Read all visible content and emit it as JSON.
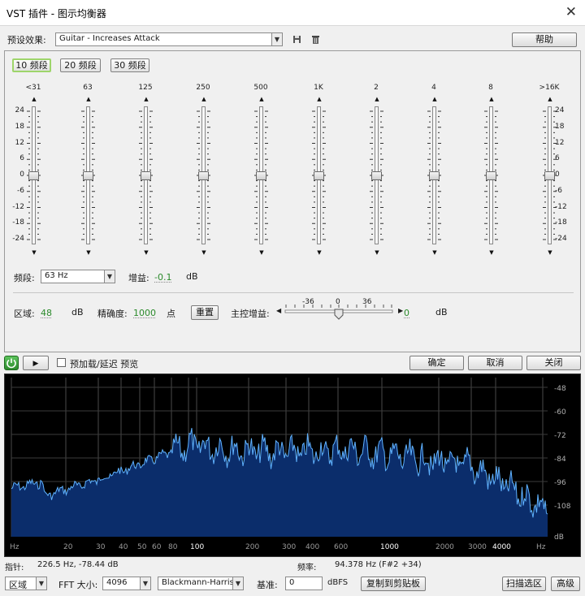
{
  "window": {
    "title": "VST 插件 - 图示均衡器",
    "close_glyph": "✕"
  },
  "preset": {
    "label": "预设效果:",
    "value": "Guitar - Increases Attack",
    "help_button": "帮助"
  },
  "bands": {
    "buttons": [
      "10 频段",
      "20 频段",
      "30 频段"
    ],
    "active_index": 0,
    "frequencies": [
      "<31",
      "63",
      "125",
      "250",
      "500",
      "1K",
      "2",
      "4",
      "8",
      ">16K"
    ],
    "gains_db": [
      0,
      0,
      0,
      0,
      0,
      0,
      0,
      0,
      0,
      0
    ],
    "db_scale": [
      "24",
      "18",
      "12",
      "6",
      "0",
      "-6",
      "-12",
      "-18",
      "-24"
    ],
    "db_range": [
      -24,
      24
    ]
  },
  "band_select": {
    "label": "频段:",
    "value": "63 Hz",
    "gain_label": "增益:",
    "gain_value": "-0.1",
    "gain_unit": "dB"
  },
  "range_row": {
    "range_label": "区域:",
    "range_value": "48",
    "range_unit": "dB",
    "accuracy_label": "精确度:",
    "accuracy_value": "1000",
    "accuracy_unit": "点",
    "reset_button": "重置",
    "master_label": "主控增益:",
    "master_scale": [
      "-36",
      "0",
      "36"
    ],
    "master_value": "0",
    "master_unit": "dB"
  },
  "controls": {
    "preload_label": "预加载/延迟 预览",
    "preload_checked": false,
    "ok": "确定",
    "cancel": "取消",
    "close": "关闭"
  },
  "spectrum": {
    "x_ticks": [
      "Hz",
      "20",
      "30",
      "40",
      "50",
      "60",
      "80",
      "100",
      "200",
      "300",
      "400",
      "600",
      "1000",
      "2000",
      "3000",
      "4000",
      "Hz"
    ],
    "y_ticks": [
      "-48",
      "-60",
      "-72",
      "-84",
      "-96",
      "-108",
      "dB"
    ],
    "fill_color": "#0b2d6b",
    "line_color": "#5fb2ff"
  },
  "status": {
    "cursor_label": "指针:",
    "cursor_value": "226.5 Hz, -78.44 dB",
    "freq_label": "频率:",
    "freq_value": "94.378 Hz (F#2 +34)"
  },
  "bottom": {
    "region_button": "区域",
    "fft_label": "FFT 大小:",
    "fft_value": "4096",
    "window_value": "Blackmann-Harris",
    "ref_label": "基准:",
    "ref_value": "0",
    "ref_unit": "dBFS",
    "copy_button": "复制到剪贴板",
    "scan_button": "扫描选区",
    "advanced_button": "高级"
  }
}
